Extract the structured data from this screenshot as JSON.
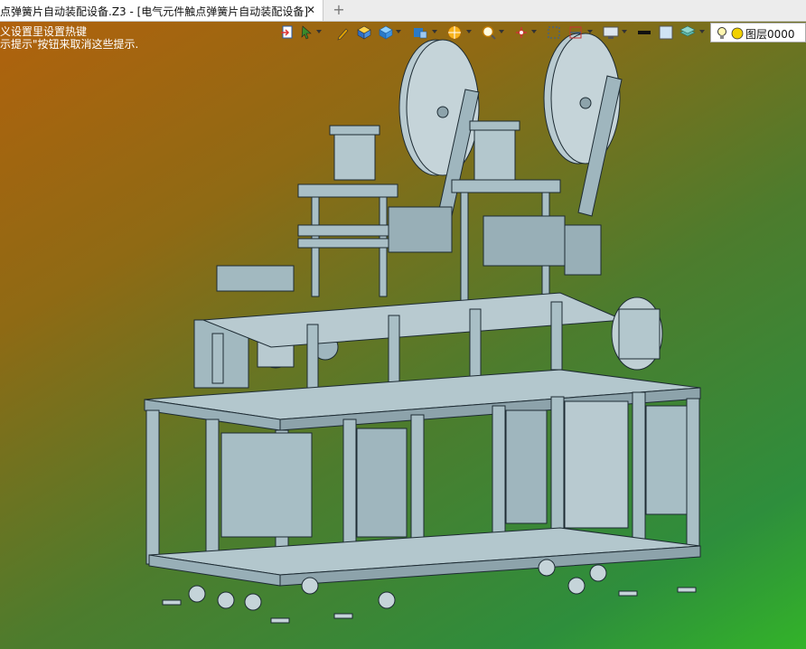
{
  "tab": {
    "title": "点弹簧片自动装配设备.Z3 - [电气元件触点弹簧片自动装配设备]",
    "close_glyph": "✕",
    "new_glyph": "+"
  },
  "hints": {
    "line1": "义设置里设置热键",
    "line2": "示提示\"按钮来取消这些提示."
  },
  "toolbar": {
    "layer_label": "图层0000",
    "icons": [
      "export-icon",
      "select-icon",
      "pencil-icon",
      "box-icon",
      "cube-icon",
      "view-cube-icon",
      "render-icon",
      "zoom-icon",
      "snap-icon",
      "frame-icon",
      "grid-icon",
      "monitor-icon",
      "line-color-icon",
      "fill-color-icon",
      "layer-stack-icon",
      "lightbulb-icon",
      "layer-color-icon"
    ]
  },
  "colors": {
    "bg_top_left": "#b0620d",
    "bg_bottom_right": "#33b329",
    "model_fill": "#a9bfc6",
    "model_line": "#1d2b33"
  }
}
